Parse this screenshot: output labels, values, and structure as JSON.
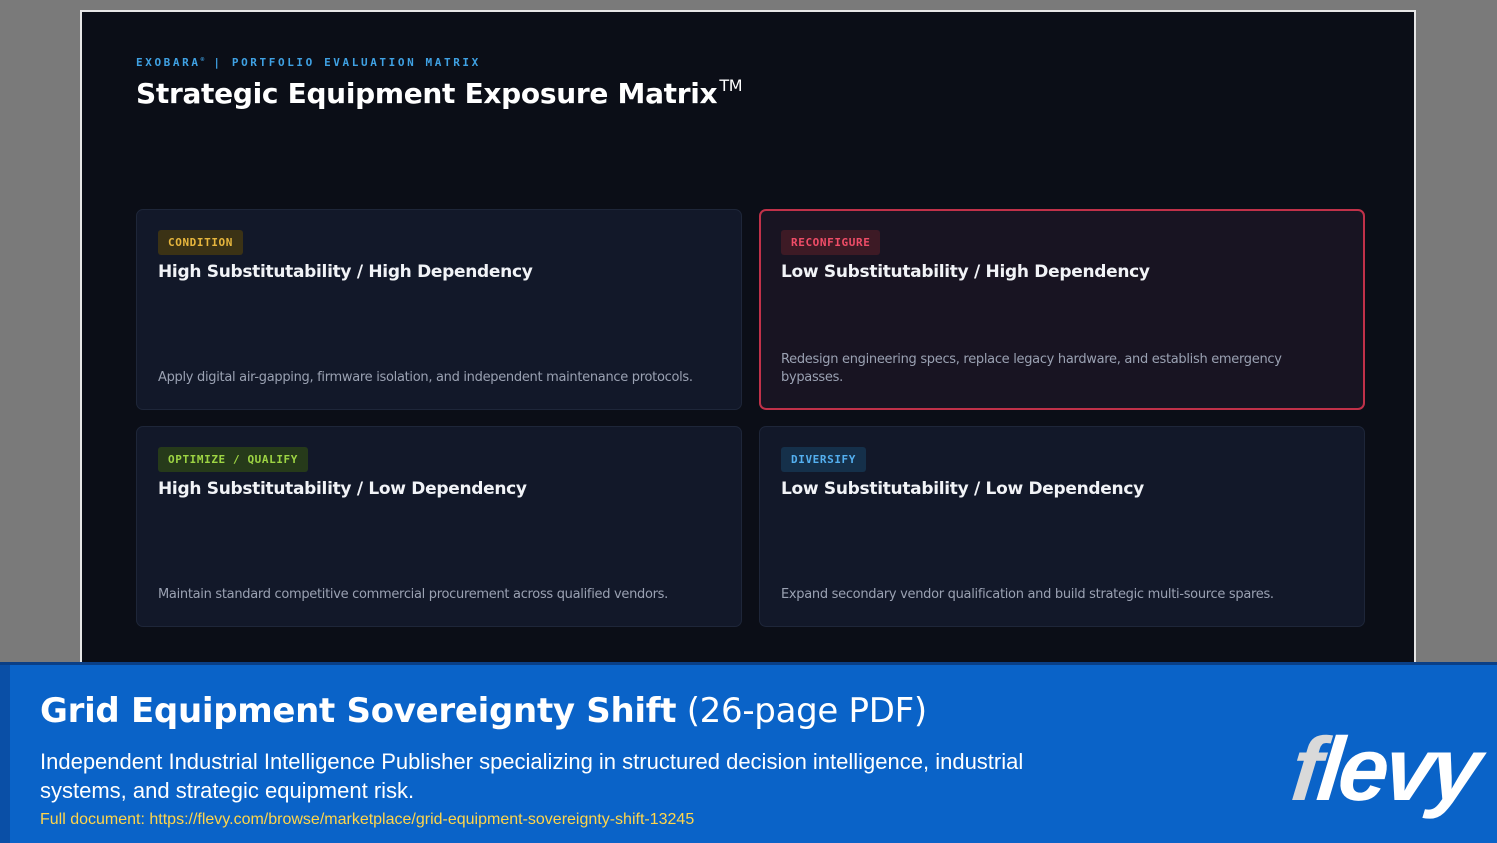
{
  "slide": {
    "eyebrow_brand": "EXOBARA",
    "eyebrow_tm": "®",
    "eyebrow_sep": " | ",
    "eyebrow_text": "PORTFOLIO EVALUATION MATRIX",
    "title": "Strategic Equipment Exposure Matrix",
    "title_tm": "TM",
    "quadrants": [
      {
        "badge": "CONDITION",
        "title": "High Substitutability / High Dependency",
        "description": "Apply digital air-gapping, firmware isolation, and independent maintenance protocols.",
        "badge_color": "#e7b63d"
      },
      {
        "badge": "RECONFIGURE",
        "title": "Low Substitutability / High Dependency",
        "description": "Redesign engineering specs, replace legacy hardware, and establish emergency bypasses.",
        "badge_color": "#f04d68",
        "border_color": "#c03149"
      },
      {
        "badge": "OPTIMIZE / QUALIFY",
        "title": "High Substitutability / Low Dependency",
        "description": "Maintain standard competitive commercial procurement across qualified vendors.",
        "badge_color": "#9dd443"
      },
      {
        "badge": "DIVERSIFY",
        "title": "Low Substitutability / Low Dependency",
        "description": "Expand secondary vendor qualification and build strategic multi-source spares.",
        "badge_color": "#54b0f0"
      }
    ]
  },
  "banner": {
    "title": "Grid Equipment Sovereignty Shift",
    "subtitle": " (26-page PDF)",
    "description": "Independent Industrial Intelligence Publisher specializing in structured decision intelligence, industrial systems, and strategic equipment risk.",
    "link_text": "Full document: https://flevy.com/browse/marketplace/grid-equipment-sovereignty-shift-13245",
    "logo_f": "f",
    "logo_rest": "levy",
    "background_color": "#0a63c8",
    "link_color": "#ffd54a"
  }
}
